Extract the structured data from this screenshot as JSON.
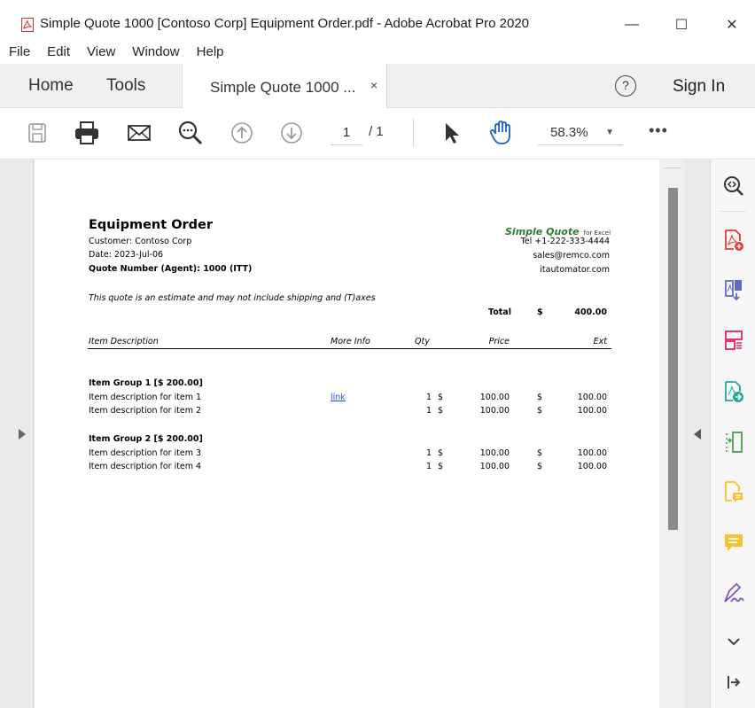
{
  "window": {
    "title": "Simple Quote 1000 [Contoso Corp] Equipment Order.pdf - Adobe Acrobat Pro 2020",
    "minimize": "—",
    "maximize": "☐",
    "close": "✕"
  },
  "menu": [
    "File",
    "Edit",
    "View",
    "Window",
    "Help"
  ],
  "tabs": {
    "home": "Home",
    "tools": "Tools",
    "document": "Simple Quote 1000 ...",
    "document_close": "×"
  },
  "header_right": {
    "help": "?",
    "signin": "Sign In"
  },
  "toolbar": {
    "icons": [
      "save-icon",
      "print-icon",
      "email-icon",
      "zoom-search-icon",
      "prev-page-icon",
      "next-page-icon",
      "select-pointer-icon",
      "hand-tool-icon"
    ],
    "page_current": "1",
    "page_total": "/ 1",
    "zoom": "58.3%",
    "more": "•••"
  },
  "right_panel": {
    "icons": [
      "zoom-in-icon",
      "create-pdf-icon",
      "export-pdf-icon",
      "organize-pages-icon",
      "edit-pdf-icon",
      "compress-icon",
      "comment-file-icon",
      "comment-icon",
      "fill-sign-icon",
      "expand-chevron-icon",
      "collapse-panel-icon"
    ]
  },
  "pdf": {
    "title": "Equipment Order",
    "customer": "Customer: Contoso Corp",
    "date": "Date: 2023-Jul-06",
    "quote_number": "Quote Number (Agent): 1000 (ITT)",
    "note": "This quote is an estimate and may not include shipping and (T)axes",
    "brand": "Simple Quote",
    "brand_sub": "for Excel",
    "tel": "Tel +1-222-333-4444",
    "email": "sales@remco.com",
    "website": "itautomator.com",
    "total_label": "Total",
    "total_currency": "$",
    "total_value": "400.00",
    "columns": {
      "description": "Item Description",
      "more_info": "More Info",
      "qty": "Qty",
      "price": "Price",
      "ext": "Ext"
    },
    "groups": [
      {
        "header": "Item Group 1 [$ 200.00]",
        "items": [
          {
            "description": "Item description for item 1",
            "more_info": "link",
            "qty": "1",
            "price_currency": "$",
            "price": "100.00",
            "ext_currency": "$",
            "ext": "100.00"
          },
          {
            "description": "Item description for item 2",
            "more_info": "",
            "qty": "1",
            "price_currency": "$",
            "price": "100.00",
            "ext_currency": "$",
            "ext": "100.00"
          }
        ]
      },
      {
        "header": "Item Group 2 [$ 200.00]",
        "items": [
          {
            "description": "Item description for item 3",
            "more_info": "",
            "qty": "1",
            "price_currency": "$",
            "price": "100.00",
            "ext_currency": "$",
            "ext": "100.00"
          },
          {
            "description": "Item description for item 4",
            "more_info": "",
            "qty": "1",
            "price_currency": "$",
            "price": "100.00",
            "ext_currency": "$",
            "ext": "100.00"
          }
        ]
      }
    ]
  }
}
